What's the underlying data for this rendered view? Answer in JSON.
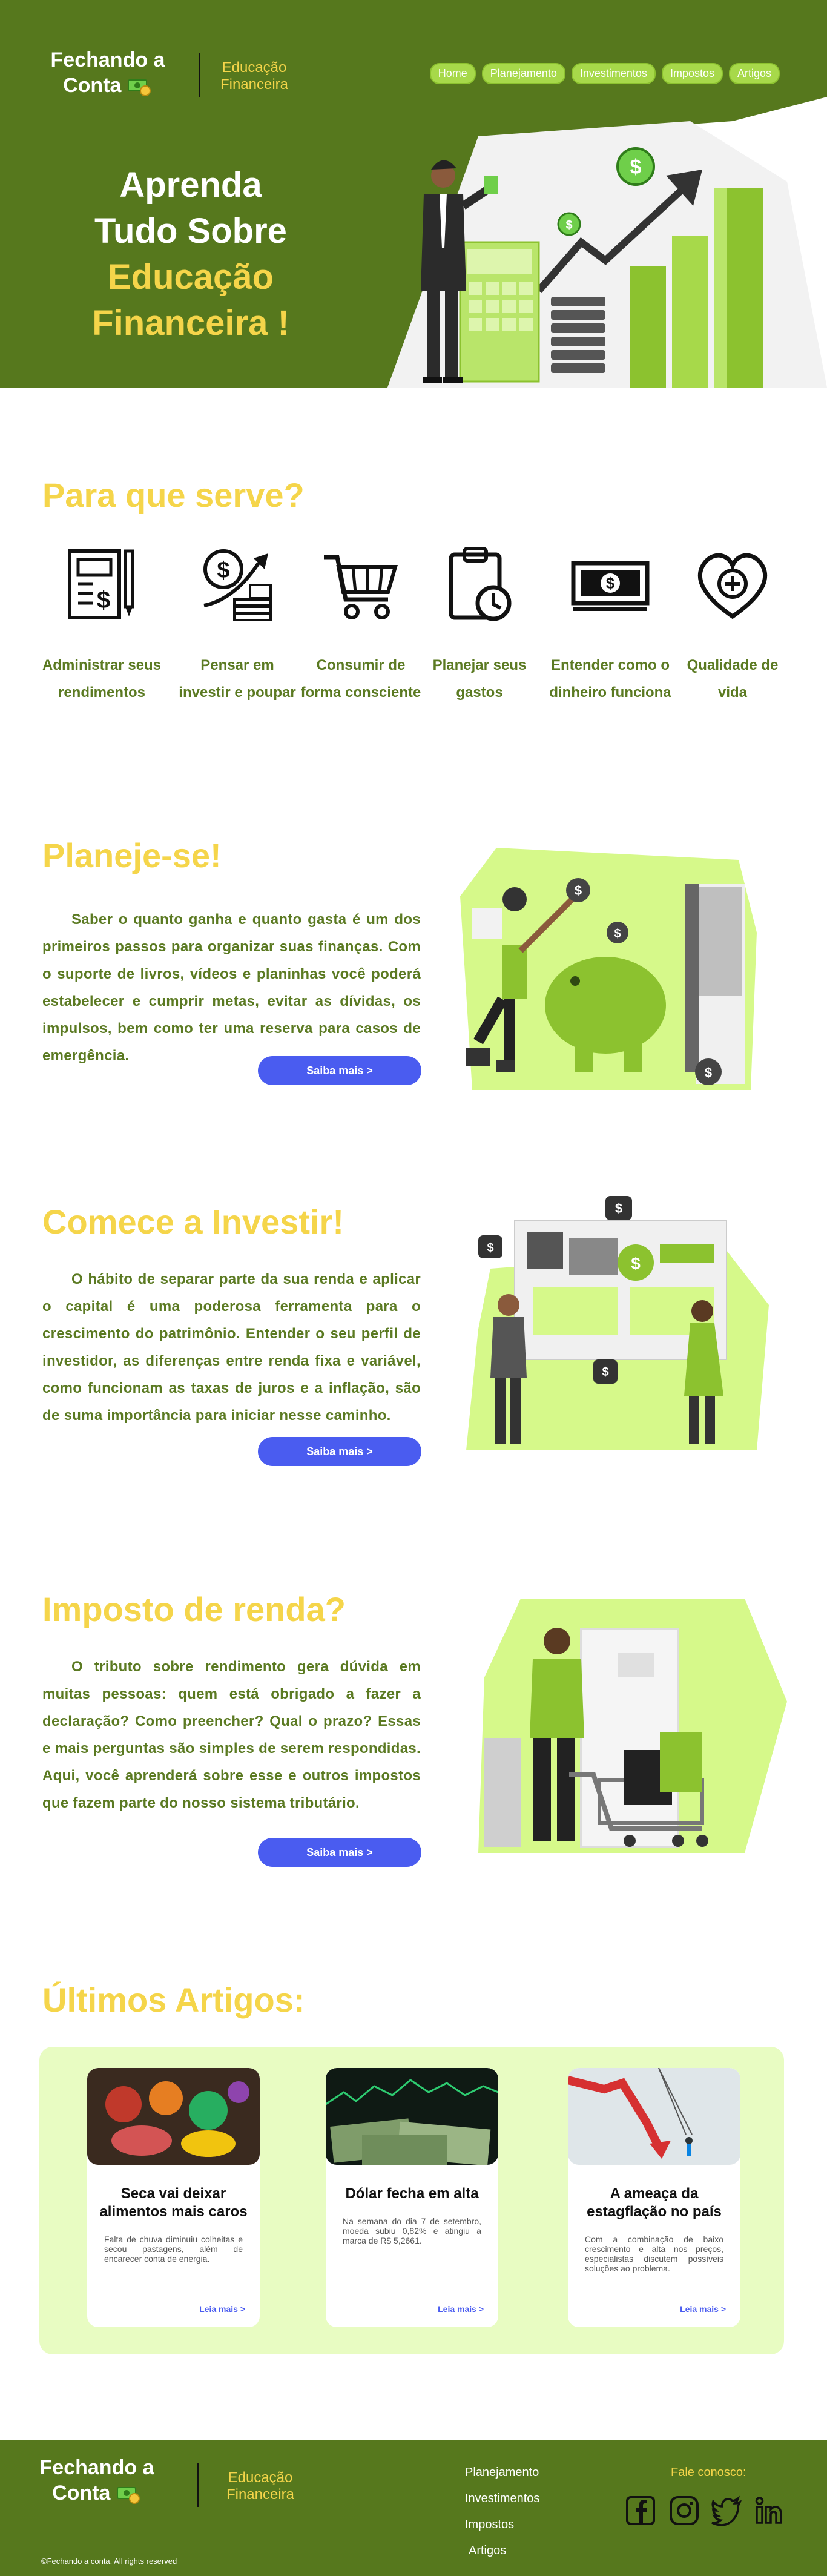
{
  "header": {
    "logo_line1": "Fechando a",
    "logo_line2": "Conta",
    "tagline_line1": "Educação",
    "tagline_line2": "Financeira",
    "nav": [
      "Home",
      "Planejamento",
      "Investimentos",
      "Impostos",
      "Artigos"
    ]
  },
  "hero": {
    "line1": "Aprenda",
    "line2": "Tudo Sobre",
    "line3": "Educação",
    "line4": "Financeira !"
  },
  "purposes": {
    "title": "Para que serve?",
    "items": [
      {
        "icon": "document-pencil-icon",
        "label_line1": "Administrar seus",
        "label_line2": "rendimentos"
      },
      {
        "icon": "coin-growth-chart-icon",
        "label_line1": "Pensar em",
        "label_line2": "investir e poupar"
      },
      {
        "icon": "shopping-cart-icon",
        "label_line1": "Consumir de",
        "label_line2": "forma consciente"
      },
      {
        "icon": "clipboard-clock-icon",
        "label_line1": "Planejar seus",
        "label_line2": "gastos"
      },
      {
        "icon": "banknotes-icon",
        "label_line1": "Entender como o",
        "label_line2": "dinheiro funciona"
      },
      {
        "icon": "heart-plus-icon",
        "label_line1": "Qualidade de",
        "label_line2": "vida"
      }
    ]
  },
  "plan": {
    "title": "Planeje-se!",
    "text": "Saber o quanto ganha e quanto gasta é um dos primeiros passos para organizar suas finanças. Com o suporte de livros, vídeos e planinhas você poderá estabelecer e cumprir metas, evitar as dívidas, os impulsos, bem como ter uma reserva para casos de emergência.",
    "button": "Saiba mais >"
  },
  "invest": {
    "title": "Comece a Investir!",
    "text": "O hábito de separar parte da sua renda e aplicar o capital é uma poderosa ferramenta para o crescimento do patrimônio. Entender o seu perfil de investidor, as diferenças entre renda fixa e variável, como funcionam as taxas de juros e a inflação, são de suma importância para iniciar nesse caminho.",
    "button": "Saiba mais >"
  },
  "tax": {
    "title": "Imposto de renda?",
    "text": "O tributo sobre rendimento gera dúvida em muitas pessoas: quem está obrigado a fazer a declaração? Como preencher? Qual o prazo? Essas e mais perguntas são simples de serem respondidas. Aqui, você aprenderá sobre esse e outros impostos que fazem parte do nosso sistema tributário.",
    "button": "Saiba mais >"
  },
  "articles": {
    "title": "Últimos Artigos:",
    "items": [
      {
        "title": "Seca vai deixar alimentos mais caros",
        "summary": "Falta de chuva diminuiu colheitas e secou pastagens, além de encarecer conta de energia.",
        "more": "Leia mais >"
      },
      {
        "title": "Dólar fecha em alta",
        "summary": "Na semana do dia 7 de setembro, moeda subiu 0,82% e atingiu a marca de R$ 5,2661.",
        "more": "Leia mais >"
      },
      {
        "title": "A ameaça da estagflação no país",
        "summary": "Com a combinação de baixo crescimento e alta nos preços, especialistas discutem possíveis soluções ao problema.",
        "more": "Leia mais >"
      }
    ]
  },
  "footer": {
    "links": [
      "Planejamento",
      "Investimentos",
      "Impostos",
      "Artigos"
    ],
    "contact_label": "Fale conosco:",
    "social": [
      "facebook-icon",
      "instagram-icon",
      "twitter-icon",
      "linkedin-icon"
    ],
    "copyright": "©Fechando a conta. All rights reserved"
  },
  "colors": {
    "brand_green": "#56781d",
    "accent_yellow": "#f5d54a",
    "light_green": "#a7d94a",
    "button_blue": "#4a5cf0",
    "panel_green": "#e8fcc2"
  }
}
